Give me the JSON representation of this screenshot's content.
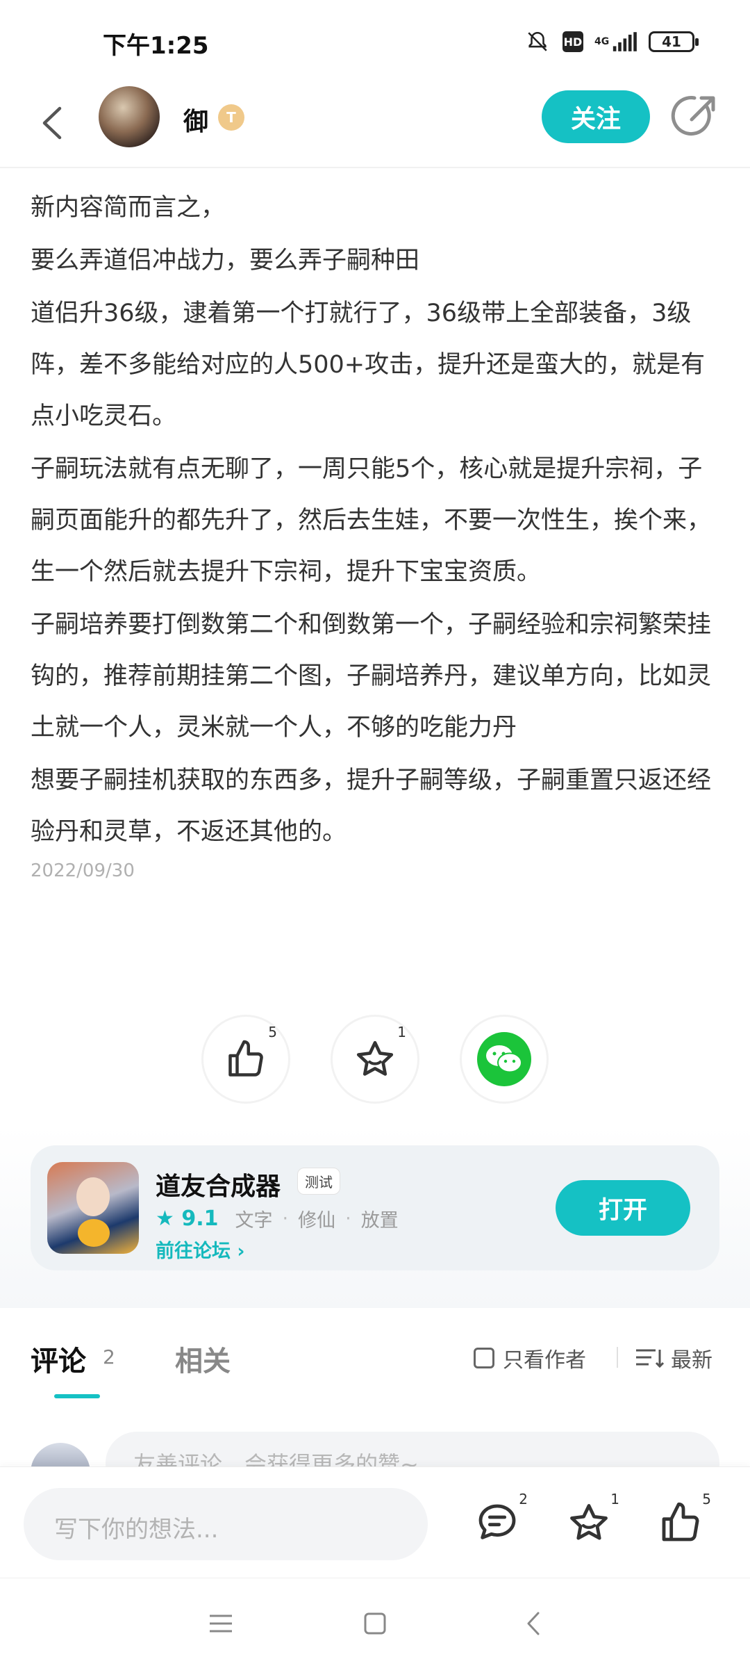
{
  "status_bar": {
    "time": "下午1:25",
    "hd_label": "HD",
    "network": "4G",
    "battery": "41"
  },
  "header": {
    "username": "御",
    "level_badge": "T",
    "follow_label": "关注"
  },
  "article": {
    "paragraphs": [
      "新内容简而言之，",
      "要么弄道侣冲战力，要么弄子嗣种田",
      "道侣升36级，逮着第一个打就行了，36级带上全部装备，3级阵，差不多能给对应的人500+攻击，提升还是蛮大的，就是有点小吃灵石。",
      "子嗣玩法就有点无聊了，一周只能5个，核心就是提升宗祠，子嗣页面能升的都先升了，然后去生娃，不要一次性生，挨个来，生一个然后就去提升下宗祠，提升下宝宝资质。",
      "子嗣培养要打倒数第二个和倒数第一个，子嗣经验和宗祠繁荣挂钩的，推荐前期挂第二个图，子嗣培养丹，建议单方向，比如灵土就一个人，灵米就一个人，不够的吃能力丹",
      "想要子嗣挂机获取的东西多，提升子嗣等级，子嗣重置只返还经验丹和灵草，不返还其他的。"
    ],
    "date": "2022/09/30"
  },
  "actions": {
    "like_count": "5",
    "favorite_count": "1"
  },
  "app_card": {
    "name": "道友合成器",
    "tag": "测试",
    "rating": "9.1",
    "genres": [
      "文字",
      "修仙",
      "放置"
    ],
    "forum_link": "前往论坛",
    "open_label": "打开"
  },
  "tabs": {
    "comments_label": "评论",
    "comments_count": "2",
    "related_label": "相关",
    "author_only_label": "只看作者",
    "sort_label": "最新"
  },
  "comment_input": {
    "placeholder": "友善评论，会获得更多的赞~"
  },
  "bottom_bar": {
    "placeholder": "写下你的想法...",
    "comment_count": "2",
    "favorite_count": "1",
    "like_count": "5"
  },
  "colors": {
    "accent": "#15c1c4",
    "wechat": "#1bc43a"
  }
}
